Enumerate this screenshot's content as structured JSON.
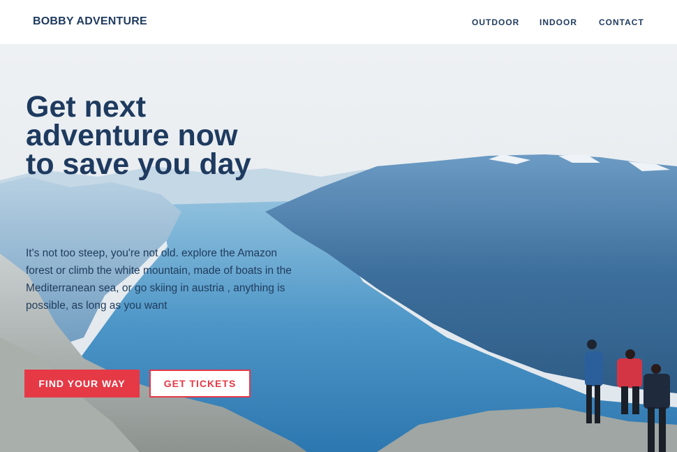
{
  "nav": {
    "brand": "BOBBY ADVENTURE",
    "links": [
      {
        "label": "OUTDOOR"
      },
      {
        "label": "INDOOR"
      },
      {
        "label": "CONTACT"
      }
    ]
  },
  "hero": {
    "headline_lines": [
      "Get next",
      "adventure now",
      "to save you day"
    ],
    "description": "It's not too steep, you're not old. explore the Amazon forest or climb the white mountain, made of boats in the Mediterranean sea, or go skiing in austria , anything is possible, as long as you want",
    "primary_button": "FIND YOUR WAY",
    "secondary_button": "GET TICKETS"
  },
  "colors": {
    "brand": "#1e3a5f",
    "accent": "#e63946",
    "background": "#ffffff"
  }
}
